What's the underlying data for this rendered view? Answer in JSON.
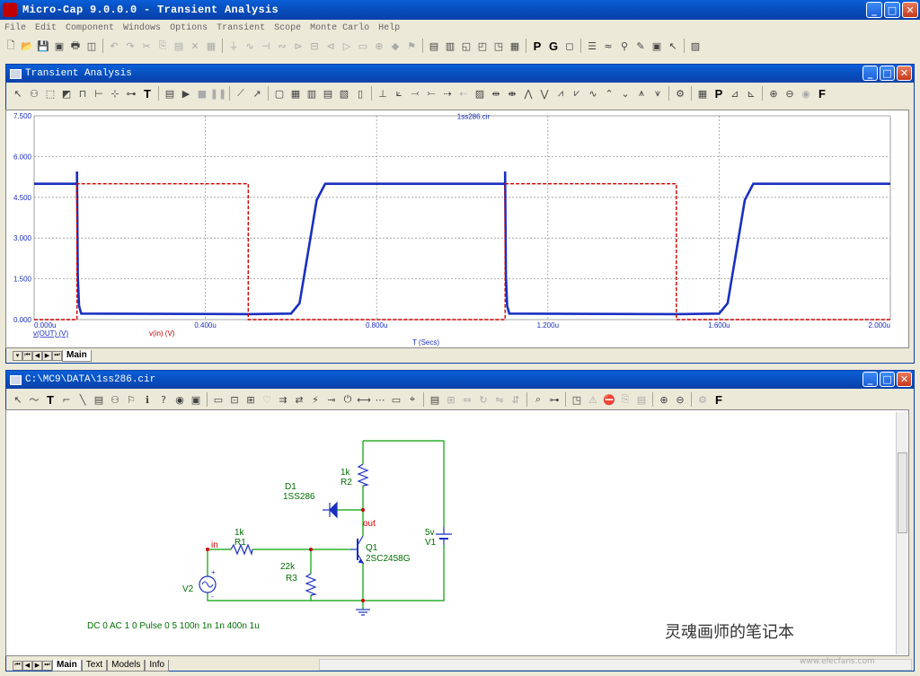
{
  "app": {
    "title": "Micro-Cap 9.0.0.0 - Transient Analysis"
  },
  "menu": [
    "File",
    "Edit",
    "Component",
    "Windows",
    "Options",
    "Transient",
    "Scope",
    "Monte Carlo",
    "Help"
  ],
  "analysis_window": {
    "title": "Transient Analysis",
    "plot_title": "1ss286.cir",
    "x_axis_label": "T (Secs)",
    "traces": [
      {
        "label": "v(OUT) (V)",
        "color": "#1a2fc0"
      },
      {
        "label": "v(in) (V)",
        "color": "#d00000"
      }
    ],
    "tabs": [
      "Main"
    ]
  },
  "chart_data": {
    "type": "line",
    "title": "1ss286.cir",
    "xlabel": "T (Secs)",
    "ylabel": "",
    "xlim": [
      0,
      2.0
    ],
    "ylim": [
      0,
      7.5
    ],
    "x_ticks": [
      "0.000u",
      "0.400u",
      "0.800u",
      "1.200u",
      "1.600u",
      "2.000u"
    ],
    "y_ticks": [
      "0.000",
      "1.500",
      "3.000",
      "4.500",
      "6.000",
      "7.500"
    ],
    "grid": true,
    "series": [
      {
        "name": "v(OUT) (V)",
        "x": [
          0,
          0.1,
          0.1,
          0.102,
          0.105,
          0.11,
          0.5,
          0.6,
          0.62,
          0.64,
          0.66,
          0.68,
          1.1,
          1.1,
          1.102,
          1.105,
          1.11,
          1.5,
          1.6,
          1.62,
          1.64,
          1.66,
          1.68,
          2.0
        ],
        "y": [
          5.0,
          5.0,
          5.45,
          1.6,
          0.5,
          0.22,
          0.2,
          0.22,
          0.6,
          2.5,
          4.4,
          5.0,
          5.0,
          5.45,
          1.6,
          0.5,
          0.22,
          0.2,
          0.22,
          0.6,
          2.5,
          4.4,
          5.0,
          5.0
        ]
      },
      {
        "name": "v(in) (V)",
        "x": [
          0,
          0.1,
          0.1,
          0.5,
          0.5,
          1.1,
          1.1,
          1.5,
          1.5,
          2.0
        ],
        "y": [
          0,
          0,
          5.0,
          5.0,
          0,
          0,
          5.0,
          5.0,
          0,
          0
        ]
      }
    ]
  },
  "schematic_window": {
    "title": "C:\\MC9\\DATA\\1ss286.cir",
    "labels": {
      "d1": "D1",
      "d1_model": "1SS286",
      "r1_val": "1k",
      "r1": "R1",
      "r2_val": "1k",
      "r2": "R2",
      "r3_val": "22k",
      "r3": "R3",
      "q1": "Q1",
      "q1_model": "2SC2458G",
      "v1_val": "5v",
      "v1": "V1",
      "v2": "V2",
      "node_in": "in",
      "node_out": "out",
      "source_spec": "DC 0 AC 1 0 Pulse 0 5 100n 1n 1n 400n 1u"
    },
    "tabs": [
      "Main",
      "Text",
      "Models",
      "Info"
    ]
  },
  "watermark": {
    "text": "灵魂画师的笔记本",
    "url": "www.elecfans.com"
  },
  "colors": {
    "titlebar": "#0850c0",
    "schematic_wire": "#00a000",
    "schematic_text": "#007000",
    "node_label": "#cc0000",
    "vout": "#1a2fc0",
    "vin": "#d00000"
  }
}
